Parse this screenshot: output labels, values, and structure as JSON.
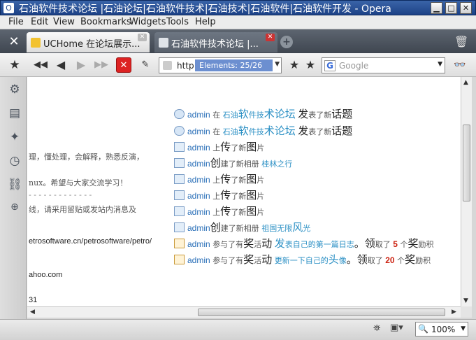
{
  "window": {
    "title": "石油软件技术论坛 |石油论坛|石油软件技术|石油技术|石油软件|石油软件开发 - Opera"
  },
  "menu": [
    "File",
    "Edit",
    "View",
    "Bookmarks",
    "Widgets",
    "Tools",
    "Help"
  ],
  "tabs": [
    {
      "label": "UCHome 在论坛展示...",
      "active": true
    },
    {
      "label": "石油软件技术论坛 |...",
      "active": false
    }
  ],
  "address": {
    "protocol": "http",
    "find_text": "Elements:  25/26"
  },
  "search": {
    "placeholder": "Google"
  },
  "left_fragments": [
    "理，懂处理，会解释，熟悉反演，",
    "nux。希望与大家交流学习！",
    "- - - - - - - - - - - - -",
    "线，请采用留贴或发站内消息及",
    "etrosoftware.cn/petrosoftware/petro/",
    "ahoo.com",
    "31"
  ],
  "activities": [
    {
      "user": "admin",
      "a": "在",
      "b": "石油",
      "c": "软",
      "d": "件技",
      "e": "术论坛",
      "f": "发",
      "g": "表了新",
      "h": "话题"
    },
    {
      "user": "admin",
      "a": "在",
      "b": "石油",
      "c": "软",
      "d": "件技",
      "e": "术论坛",
      "f": "发",
      "g": "表了新",
      "h": "话题"
    },
    {
      "user": "admin",
      "a": "上",
      "b": "传",
      "c": "了新",
      "d": "图",
      "e": "片"
    },
    {
      "user": "admin",
      "a": "创",
      "b": "建了新相册",
      "c": "桂林之行"
    },
    {
      "user": "admin",
      "a": "上",
      "b": "传",
      "c": "了新",
      "d": "图",
      "e": "片"
    },
    {
      "user": "admin",
      "a": "上",
      "b": "传",
      "c": "了新",
      "d": "图",
      "e": "片"
    },
    {
      "user": "admin",
      "a": "上",
      "b": "传",
      "c": "了新",
      "d": "图",
      "e": "片"
    },
    {
      "user": "admin",
      "a": "创",
      "b": "建了新相册",
      "c": "祖国无限",
      "d": "风",
      "e": "光"
    },
    {
      "user": "admin",
      "a": "参与了有",
      "b": "奖",
      "c": "活",
      "d": "动",
      "e": "发",
      "f": "表自己的第一篇日志",
      "g": "。领",
      "h": "取了",
      "i": "5",
      "j": "个",
      "k": "奖",
      "l": "励积"
    },
    {
      "user": "admin",
      "a": "参与了有",
      "b": "奖",
      "c": "活",
      "d": "动",
      "e": "更新一下自己的",
      "f": "头",
      "g": "像",
      "h": "。领",
      "i": "取了",
      "j": "20",
      "k": "个",
      "l": "奖",
      "m": "励积"
    }
  ],
  "status": {
    "zoom": "100%"
  }
}
